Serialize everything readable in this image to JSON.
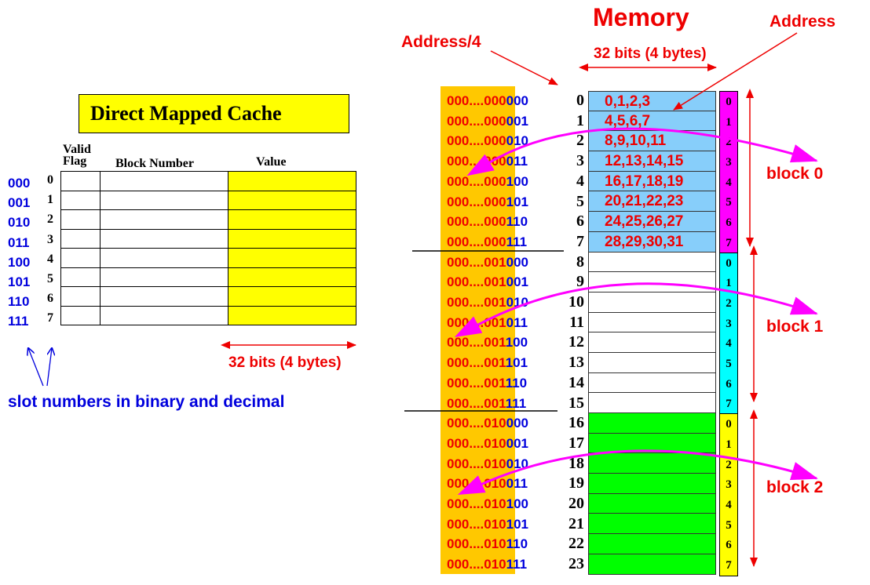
{
  "cache": {
    "title": "Direct Mapped Cache",
    "col_valid_line1": "Valid",
    "col_valid_line2": "Flag",
    "col_block": "Block Number",
    "col_value": "Value",
    "slots_binary": [
      "000",
      "001",
      "010",
      "011",
      "100",
      "101",
      "110",
      "111"
    ],
    "slots_decimal": [
      "0",
      "1",
      "2",
      "3",
      "4",
      "5",
      "6",
      "7"
    ],
    "width_label": "32 bits (4 bytes)",
    "note": "slot numbers in binary and decimal"
  },
  "memory": {
    "title": "Memory",
    "address_label": "Address",
    "address4_label": "Address/4",
    "width_label": "32 bits (4 bytes)",
    "addr_prefix": [
      "000....000",
      "000....000",
      "000....000",
      "000....000",
      "000....000",
      "000....000",
      "000....000",
      "000....000",
      "000....001",
      "000....001",
      "000....001",
      "000....001",
      "000....001",
      "000....001",
      "000....001",
      "000....001",
      "000....010",
      "000....010",
      "000....010",
      "000....010",
      "000....010",
      "000....010",
      "000....010",
      "000....010"
    ],
    "addr_suffix": [
      "000",
      "001",
      "010",
      "011",
      "100",
      "101",
      "110",
      "111",
      "000",
      "001",
      "010",
      "011",
      "100",
      "101",
      "110",
      "111",
      "000",
      "001",
      "010",
      "011",
      "100",
      "101",
      "110",
      "111"
    ],
    "row_numbers": [
      "0",
      "1",
      "2",
      "3",
      "4",
      "5",
      "6",
      "7",
      "8",
      "9",
      "10",
      "11",
      "12",
      "13",
      "14",
      "15",
      "16",
      "17",
      "18",
      "19",
      "20",
      "21",
      "22",
      "23"
    ],
    "cell_values": [
      "0,1,2,3",
      "4,5,6,7",
      "8,9,10,11",
      "12,13,14,15",
      "16,17,18,19",
      "20,21,22,23",
      "24,25,26,27",
      "28,29,30,31",
      "",
      "",
      "",
      "",
      "",
      "",
      "",
      "",
      "",
      "",
      "",
      "",
      "",
      "",
      "",
      ""
    ],
    "block_slot_labels": [
      "0",
      "1",
      "2",
      "3",
      "4",
      "5",
      "6",
      "7"
    ],
    "blocks": [
      {
        "label": "block 0",
        "color": "#ff00ff",
        "cell_color": "#87cefa"
      },
      {
        "label": "block 1",
        "color": "#00ffff",
        "cell_color": "#ffffff"
      },
      {
        "label": "block 2",
        "color": "#ffff00",
        "cell_color": "#00ff00"
      }
    ]
  },
  "colors": {
    "red": "#ee0000",
    "blue": "#0000dd",
    "magenta": "#ff00ff",
    "orange": "#ffc800",
    "yellow": "#ffff00"
  }
}
